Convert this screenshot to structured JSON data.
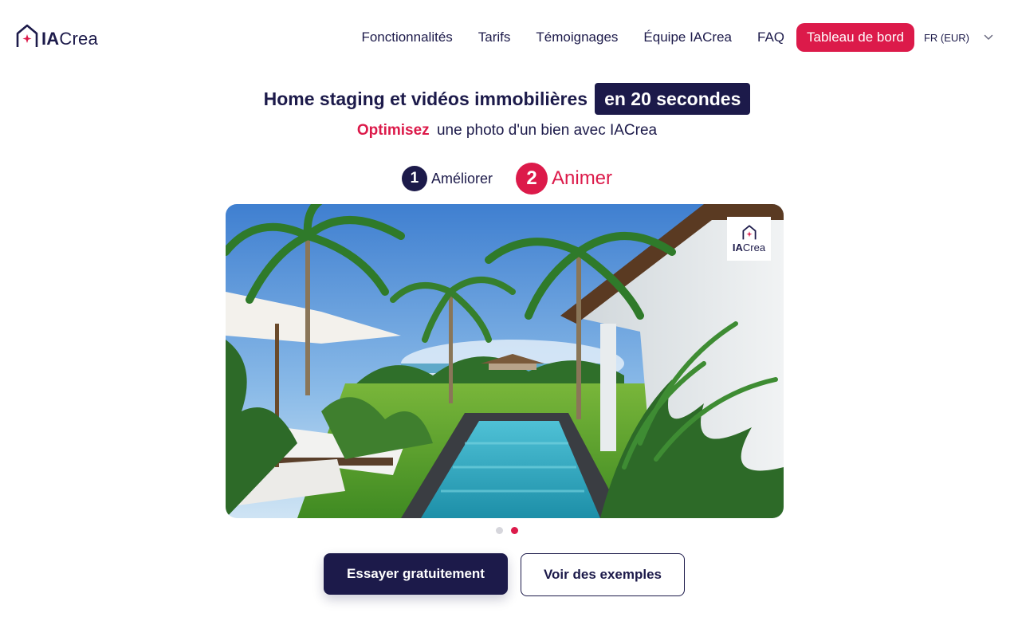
{
  "brand": {
    "logo_bold": "IA",
    "logo_light": "Crea",
    "primary_color": "#1c1a4a",
    "accent_color": "#dc1a4a"
  },
  "nav": {
    "links": [
      "Fonctionnalités",
      "Tarifs",
      "Témoignages",
      "Équipe IACrea",
      "FAQ"
    ],
    "dashboard_button": "Tableau de bord",
    "language": "FR (EUR)",
    "language_icon": "chevron-down-icon"
  },
  "hero": {
    "title": "Home staging et vidéos immobilières",
    "badge": "en 20 secondes",
    "subtitle_accent": "Optimisez",
    "subtitle_rest": "une photo d'un bien avec IACrea"
  },
  "steps": [
    {
      "number": "1",
      "label": "Améliorer",
      "active": false
    },
    {
      "number": "2",
      "label": "Animer",
      "active": true
    }
  ],
  "carousel": {
    "image_description_icon": "tropical-pool-villa-image",
    "watermark_bold": "IA",
    "watermark_light": "Crea",
    "slides": 2,
    "active_slide": 2
  },
  "cta": {
    "primary": "Essayer gratuitement",
    "secondary": "Voir des exemples"
  }
}
